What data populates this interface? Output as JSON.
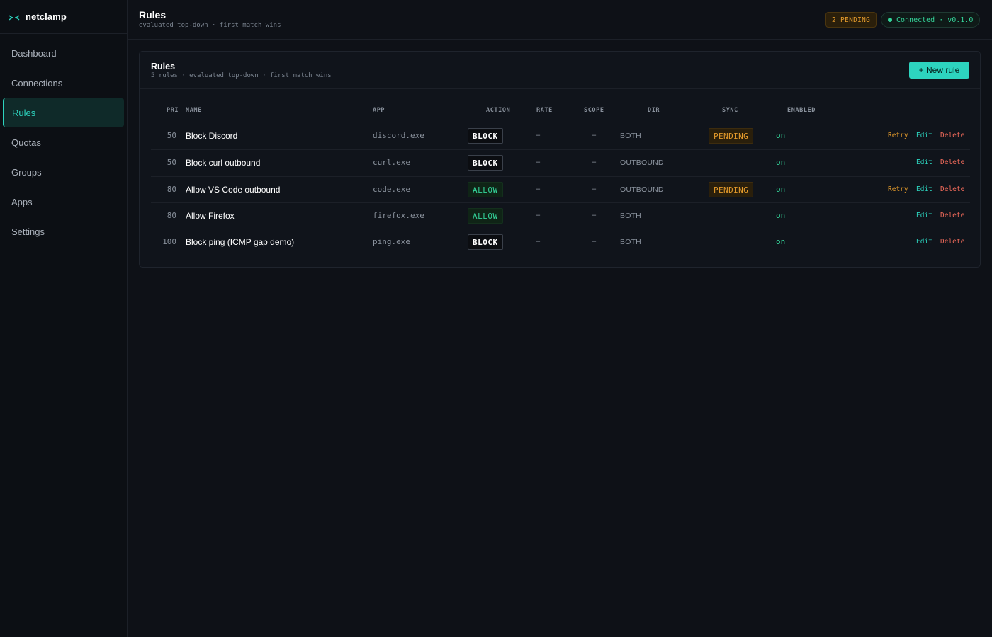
{
  "brand": {
    "name": "netclamp",
    "icon": "network-clamp-icon",
    "accent": "#2dd4bf"
  },
  "sidebar": {
    "items": [
      {
        "label": "Dashboard",
        "active": false
      },
      {
        "label": "Connections",
        "active": false
      },
      {
        "label": "Rules",
        "active": true
      },
      {
        "label": "Quotas",
        "active": false
      },
      {
        "label": "Groups",
        "active": false
      },
      {
        "label": "Apps",
        "active": false
      },
      {
        "label": "Settings",
        "active": false
      }
    ]
  },
  "header": {
    "title": "Rules",
    "subtitle": "evaluated top-down · first match wins",
    "pending_badge": "2 PENDING",
    "connection_status": "Connected · v0.1.0"
  },
  "card": {
    "title": "Rules",
    "subtitle": "5 rules · evaluated top-down · first match wins",
    "new_rule_label": "+ New rule"
  },
  "table": {
    "columns": [
      "PRI",
      "NAME",
      "APP",
      "ACTION",
      "RATE",
      "SCOPE",
      "DIR",
      "SYNC",
      "ENABLED"
    ],
    "rows": [
      {
        "pri": "50",
        "name": "Block Discord",
        "app": "discord.exe",
        "action": "BLOCK",
        "rate": "–",
        "scope": "–",
        "dir": "BOTH",
        "sync": "PENDING",
        "enabled": "on",
        "retry": "Retry",
        "edit": "Edit",
        "delete": "Delete"
      },
      {
        "pri": "50",
        "name": "Block curl outbound",
        "app": "curl.exe",
        "action": "BLOCK",
        "rate": "–",
        "scope": "–",
        "dir": "OUTBOUND",
        "sync": "",
        "enabled": "on",
        "retry": "",
        "edit": "Edit",
        "delete": "Delete"
      },
      {
        "pri": "80",
        "name": "Allow VS Code outbound",
        "app": "code.exe",
        "action": "ALLOW",
        "rate": "–",
        "scope": "–",
        "dir": "OUTBOUND",
        "sync": "PENDING",
        "enabled": "on",
        "retry": "Retry",
        "edit": "Edit",
        "delete": "Delete"
      },
      {
        "pri": "80",
        "name": "Allow Firefox",
        "app": "firefox.exe",
        "action": "ALLOW",
        "rate": "–",
        "scope": "–",
        "dir": "BOTH",
        "sync": "",
        "enabled": "on",
        "retry": "",
        "edit": "Edit",
        "delete": "Delete"
      },
      {
        "pri": "100",
        "name": "Block ping (ICMP gap demo)",
        "app": "ping.exe",
        "action": "BLOCK",
        "rate": "–",
        "scope": "–",
        "dir": "BOTH",
        "sync": "",
        "enabled": "on",
        "retry": "",
        "edit": "Edit",
        "delete": "Delete"
      }
    ]
  },
  "colors": {
    "accent": "#2dd4bf",
    "pending": "#e39a2b",
    "ok": "#34d399",
    "danger": "#f26b5b",
    "background": "#0e1117"
  }
}
